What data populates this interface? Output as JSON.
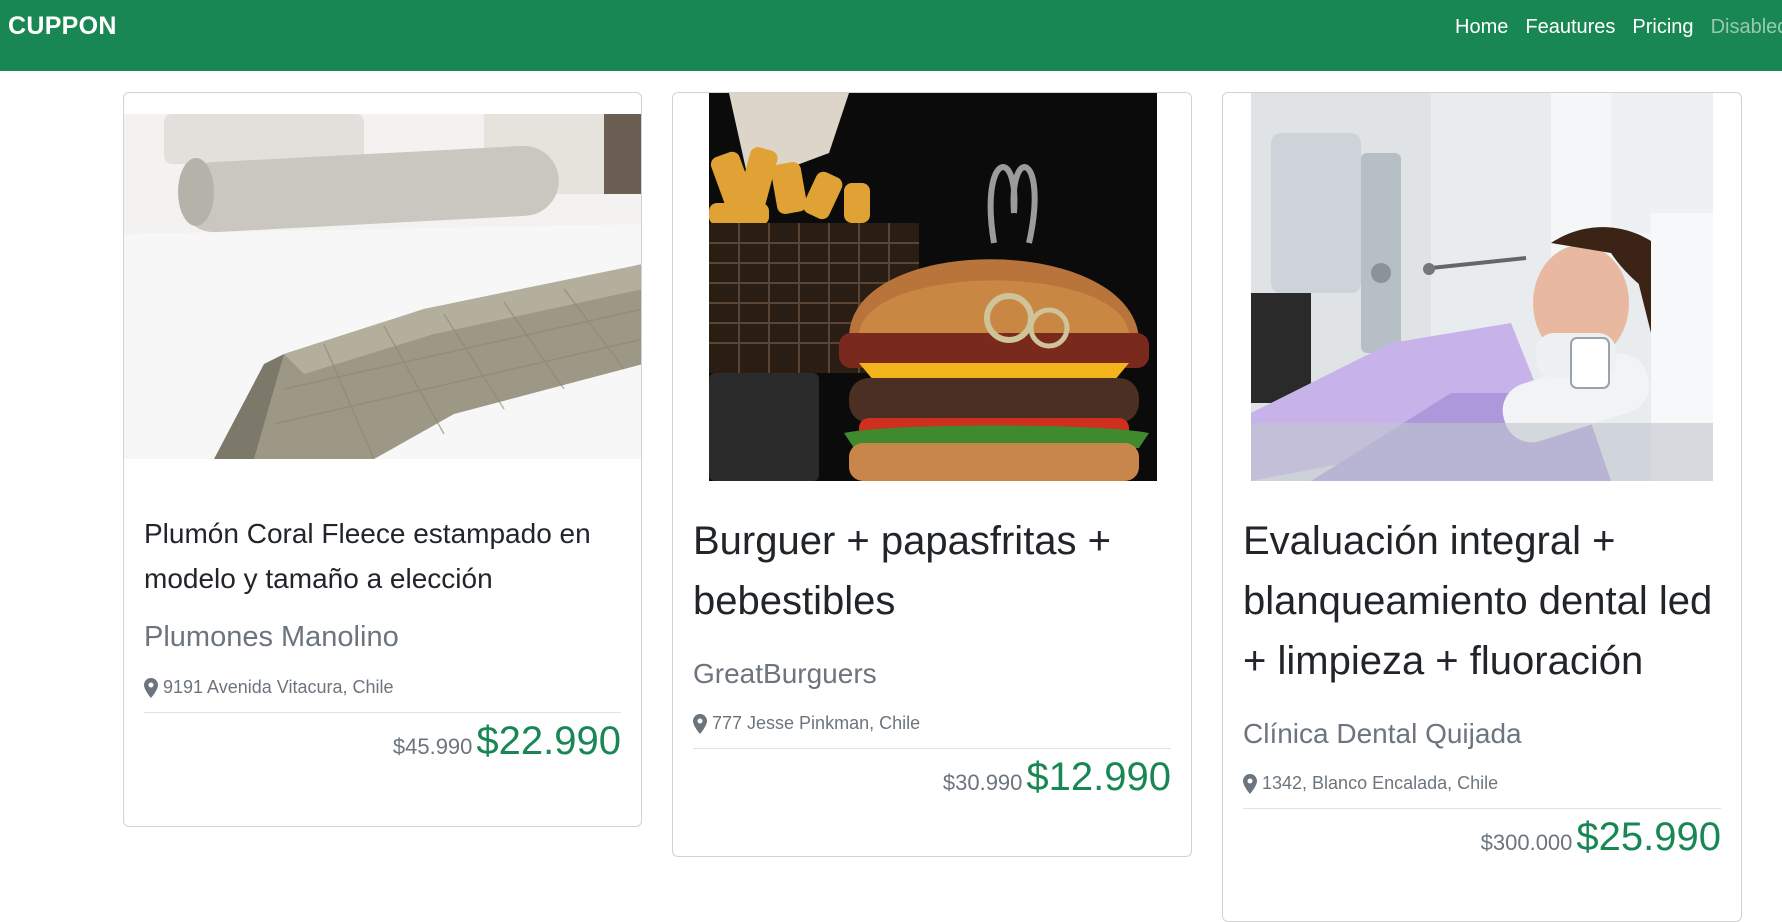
{
  "navbar": {
    "brand": "CUPPON",
    "links": [
      {
        "label": "Home"
      },
      {
        "label": "Feautures"
      },
      {
        "label": "Pricing"
      },
      {
        "label": "Disabled"
      }
    ],
    "color": "#198754"
  },
  "cards": [
    {
      "title": "Plumón Coral Fleece estampado en modelo y tamaño a elección",
      "company": "Plumones Manolino",
      "address": "9191 Avenida Vitacura, Chile",
      "old_price": "$45.990",
      "new_price": "$22.990"
    },
    {
      "title": "Burguer + papasfritas + bebestibles",
      "company": "GreatBurguers",
      "address": "777 Jesse Pinkman, Chile",
      "old_price": "$30.990",
      "new_price": "$12.990"
    },
    {
      "title": "Evaluación integral + blanqueamiento dental led + limpieza + fluoración",
      "company": "Clínica Dental Quijada",
      "address": "1342, Blanco Encalada, Chile",
      "old_price": "$300.000",
      "new_price": "$25.990"
    }
  ],
  "accent_color": "#198754"
}
